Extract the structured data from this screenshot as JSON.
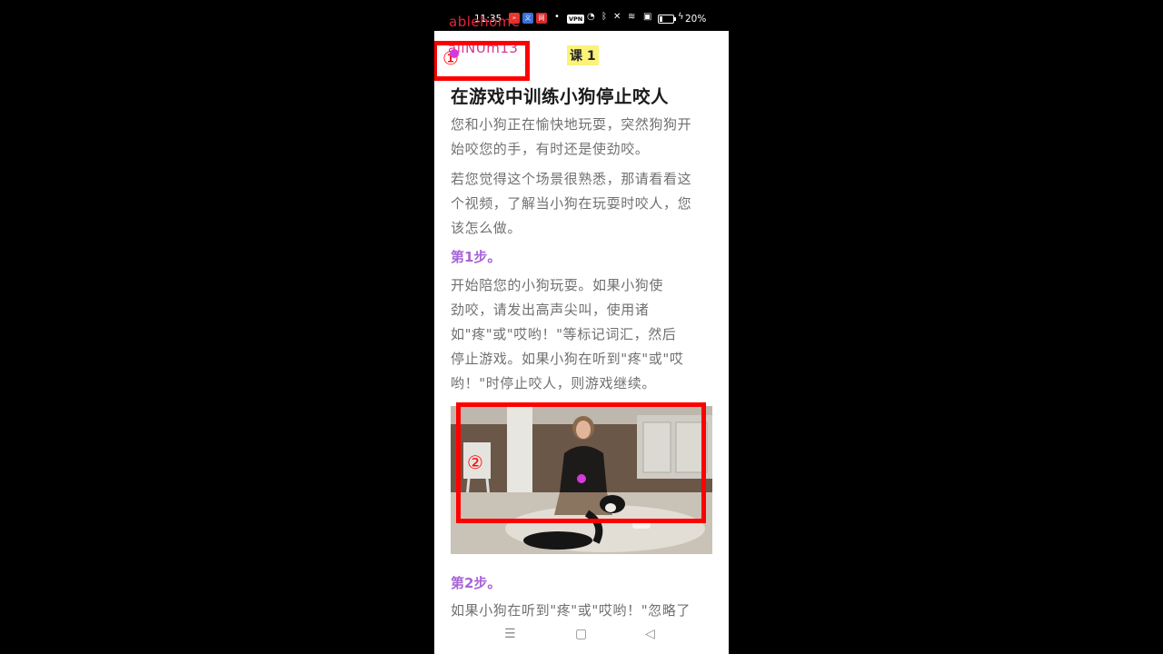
{
  "status_bar": {
    "time": "11:35",
    "vpn_label": "VPN",
    "battery_percent": "20%",
    "battery_level": 0.2,
    "overlay_label": "ablehome",
    "app_icon_colors": [
      "#e6382c",
      "#3b6fd8",
      "#d9282c"
    ],
    "app_icon_glyphs": [
      "»",
      "义",
      "网"
    ]
  },
  "header": {
    "logo_text": "allNUm13",
    "lesson_badge": "课 1"
  },
  "article": {
    "title": "在游戏中训练小狗停止咬人",
    "intro_1_lines": [
      "您和小狗正在愉快地玩耍，突然狗狗开",
      "始咬您的手，有时还是使劲咬。"
    ],
    "intro_2_lines": [
      "若您觉得这个场景很熟悉，那请看看这",
      "个视频，了解当小狗在玩耍时咬人，您",
      "该怎么做。"
    ],
    "step1_heading": "第1步。",
    "step1_lines": [
      "开始陪您的小狗玩耍。如果小狗使",
      "劲咬，请发出高声尖叫，使用诸",
      "如\"疼\"或\"哎哟！\"等标记词汇，然后",
      "停止游戏。如果小狗在听到\"疼\"或\"哎",
      "哟！\"时停止咬人，则游戏继续。"
    ],
    "step2_heading": "第2步。",
    "step2_line": "如果小狗在听到\"疼\"或\"哎哟！\"忽略了"
  },
  "annotations": {
    "box1_number": "①",
    "box2_number": "②"
  },
  "nav": {
    "menu_icon": "☰",
    "home_icon": "▢",
    "back_icon": "◁"
  }
}
